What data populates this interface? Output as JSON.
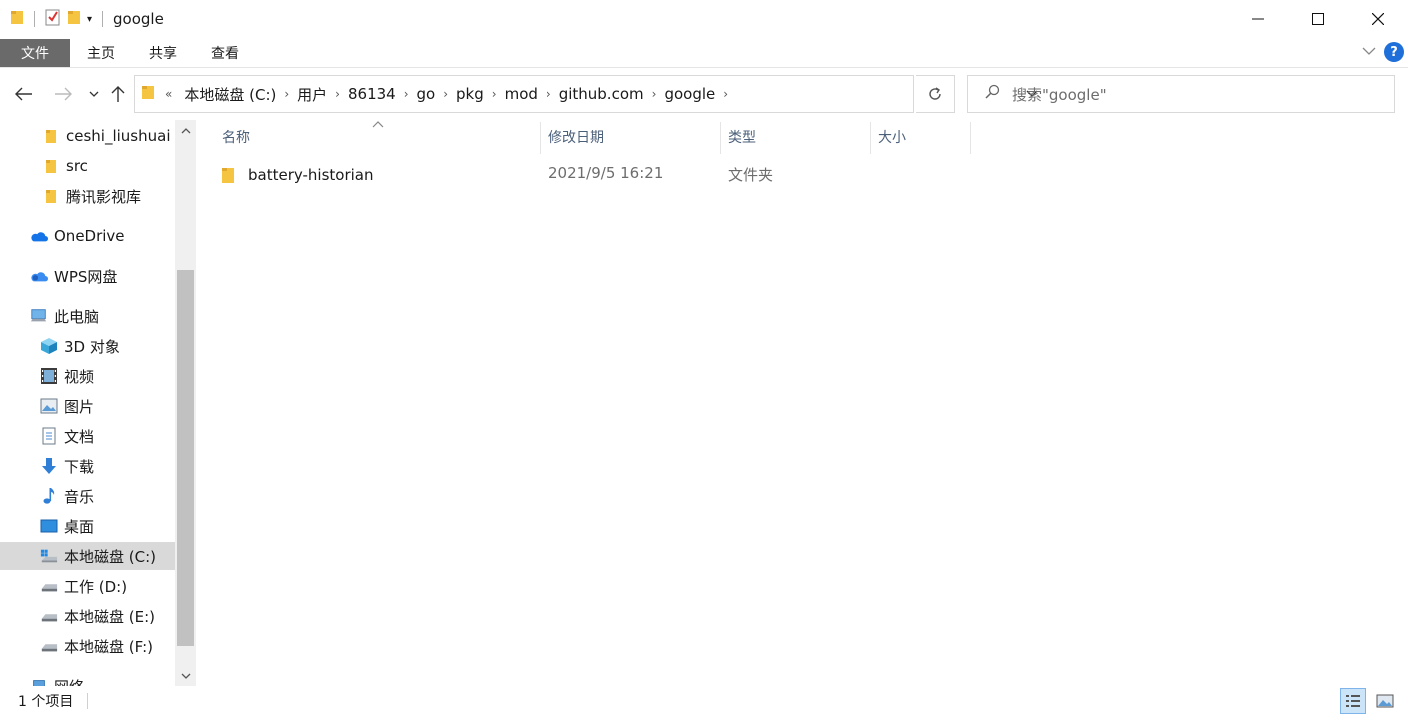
{
  "window": {
    "title": "google"
  },
  "ribbon": {
    "tabs": [
      "文件",
      "主页",
      "共享",
      "查看"
    ]
  },
  "address": {
    "overflow": "«",
    "crumbs": [
      "本地磁盘 (C:)",
      "用户",
      "86134",
      "go",
      "pkg",
      "mod",
      "github.com",
      "google"
    ]
  },
  "search": {
    "placeholder": "搜索\"google\""
  },
  "sidebar": {
    "items": [
      {
        "label": "ceshi_liushuai",
        "icon": "folder-icon"
      },
      {
        "label": "src",
        "icon": "folder-icon"
      },
      {
        "label": "腾讯影视库",
        "icon": "folder-icon"
      },
      {
        "label": "OneDrive",
        "icon": "onedrive-icon"
      },
      {
        "label": "WPS网盘",
        "icon": "wps-cloud-icon"
      },
      {
        "label": "此电脑",
        "icon": "computer-icon"
      },
      {
        "label": "3D 对象",
        "icon": "3d-objects-icon"
      },
      {
        "label": "视频",
        "icon": "video-icon"
      },
      {
        "label": "图片",
        "icon": "pictures-icon"
      },
      {
        "label": "文档",
        "icon": "documents-icon"
      },
      {
        "label": "下载",
        "icon": "download-icon"
      },
      {
        "label": "音乐",
        "icon": "music-icon"
      },
      {
        "label": "桌面",
        "icon": "desktop-icon"
      },
      {
        "label": "本地磁盘 (C:)",
        "icon": "system-drive-icon",
        "selected": true
      },
      {
        "label": "工作 (D:)",
        "icon": "drive-icon"
      },
      {
        "label": "本地磁盘 (E:)",
        "icon": "drive-icon"
      },
      {
        "label": "本地磁盘 (F:)",
        "icon": "drive-icon"
      },
      {
        "label": "网络",
        "icon": "network-icon"
      }
    ]
  },
  "columns": {
    "name": "名称",
    "date": "修改日期",
    "type": "类型",
    "size": "大小"
  },
  "files": [
    {
      "name": "battery-historian",
      "date": "2021/9/5 16:21",
      "type": "文件夹",
      "size": ""
    }
  ],
  "status": {
    "count": "1 个项目"
  },
  "colors": {
    "folder": "#f5c542",
    "accent": "#1e6fd9",
    "selected": "#d9d9d9",
    "file_tab": "#6a6a6a"
  }
}
